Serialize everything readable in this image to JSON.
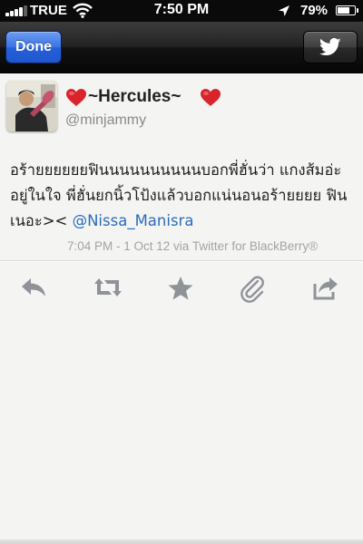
{
  "status_bar": {
    "carrier": "TRUE",
    "time": "7:50 PM",
    "battery_percent": "79%",
    "battery_level": 0.79,
    "signal_bars": 4,
    "icons": [
      "signal-icon",
      "wifi-icon",
      "location-arrow-icon",
      "battery-icon"
    ]
  },
  "nav": {
    "done_label": "Done",
    "share_icon": "twitter-bird-icon"
  },
  "tweet": {
    "display_name": "~Hercules~",
    "username": "@minjammy",
    "text": "อร้ายยยยยยฟินนนนนนนนนนบอกพี่ฮั่นว่า แกงส้มอ่ะอยู่ในใจ พี่ฮั่นยกนิ้วโป้งแล้วบอกแน่นอนอร้ายยยย ฟินเนอะ><",
    "mention": "@Nissa_Manisra",
    "meta": "7:04 PM - 1 Oct 12  via Twitter for BlackBerry®"
  },
  "actions": [
    {
      "name": "reply-icon"
    },
    {
      "name": "retweet-icon"
    },
    {
      "name": "favorite-star-icon"
    },
    {
      "name": "attachment-clip-icon"
    },
    {
      "name": "share-icon"
    }
  ],
  "colors": {
    "nav_bg": "#1c1c1c",
    "done_button": "#3a73e4",
    "mention": "#2b6cbf",
    "heart": "#d9242b",
    "background": "#f4f4f2",
    "action_icon": "#8f9398"
  }
}
